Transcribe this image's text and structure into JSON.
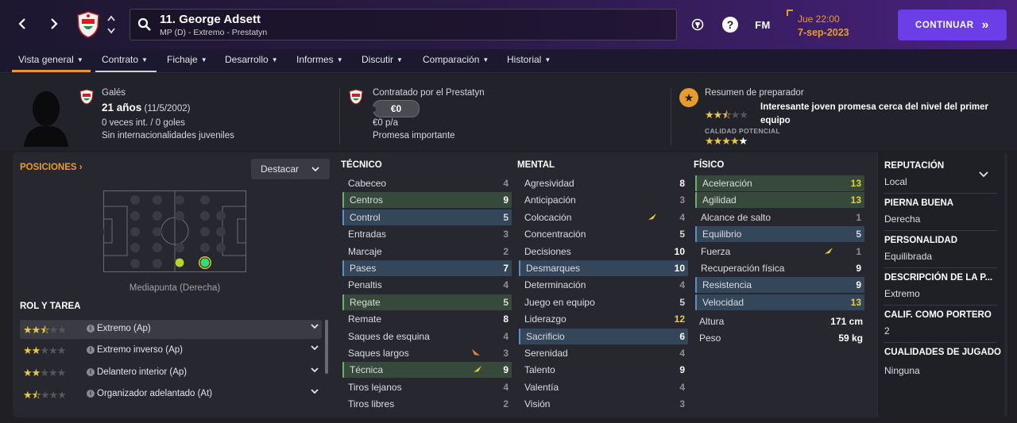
{
  "header": {
    "player_title": "11. George Adsett",
    "player_subtitle": "MP (D) - Extremo - Prestatyn",
    "date_time": "Jue 22:00",
    "date_day": "7-sep-2023",
    "fm_label": "FM",
    "help_label": "?",
    "continue_label": "CONTINUAR",
    "continue_icon": "»",
    "accent_color": "#e89b2e",
    "button_color": "#6b3ee8"
  },
  "tabs": [
    {
      "label": "Vista general"
    },
    {
      "label": "Contrato"
    },
    {
      "label": "Fichaje"
    },
    {
      "label": "Desarrollo"
    },
    {
      "label": "Informes"
    },
    {
      "label": "Discutir"
    },
    {
      "label": "Comparación"
    },
    {
      "label": "Historial"
    }
  ],
  "profile": {
    "nationality": "Galés",
    "age": "21 años",
    "dob": "(11/5/2002)",
    "caps": "0 veces int. / 0 goles",
    "youth_caps": "Sin internacionalidades juveniles",
    "contract_label": "Contratado por el Prestatyn",
    "wage": "€0",
    "wage_period": "€0 p/a",
    "status": "Promesa importante",
    "coach_title": "Resumen de preparador",
    "coach_summary": "Interesante joven promesa cerca del nivel del primer equipo",
    "potential_label": "CALIDAD POTENCIAL",
    "current_ability_stars": 2.5,
    "potential_ability_stars": 4.5
  },
  "positions": {
    "heading": "POSICIONES",
    "highlight_label": "Destacar",
    "position_name": "Mediapunta (Derecha)"
  },
  "roles": {
    "heading": "ROL Y TAREA",
    "items": [
      {
        "name": "Extremo (Ap)",
        "stars": 2.5,
        "active": true
      },
      {
        "name": "Extremo inverso (Ap)",
        "stars": 2.0,
        "active": false
      },
      {
        "name": "Delantero interior (Ap)",
        "stars": 2.0,
        "active": false
      },
      {
        "name": "Organizador adelantado (At)",
        "stars": 1.5,
        "active": false
      }
    ]
  },
  "technical": {
    "heading": "TÉCNICO",
    "attrs": [
      {
        "name": "Cabeceo",
        "value": "4",
        "hl": ""
      },
      {
        "name": "Centros",
        "value": "9",
        "hl": "green"
      },
      {
        "name": "Control",
        "value": "5",
        "hl": "blue"
      },
      {
        "name": "Entradas",
        "value": "3",
        "hl": ""
      },
      {
        "name": "Marcaje",
        "value": "2",
        "hl": ""
      },
      {
        "name": "Pases",
        "value": "7",
        "hl": "blue"
      },
      {
        "name": "Penaltis",
        "value": "4",
        "hl": ""
      },
      {
        "name": "Regate",
        "value": "5",
        "hl": "green"
      },
      {
        "name": "Remate",
        "value": "8",
        "hl": ""
      },
      {
        "name": "Saques de esquina",
        "value": "4",
        "hl": ""
      },
      {
        "name": "Saques largos",
        "value": "3",
        "hl": "",
        "trend": "down"
      },
      {
        "name": "Técnica",
        "value": "9",
        "hl": "green",
        "trend": "up"
      },
      {
        "name": "Tiros lejanos",
        "value": "4",
        "hl": ""
      },
      {
        "name": "Tiros libres",
        "value": "2",
        "hl": ""
      }
    ]
  },
  "mental": {
    "heading": "MENTAL",
    "attrs": [
      {
        "name": "Agresividad",
        "value": "8",
        "hl": ""
      },
      {
        "name": "Anticipación",
        "value": "3",
        "hl": ""
      },
      {
        "name": "Colocación",
        "value": "4",
        "hl": "",
        "trend": "up"
      },
      {
        "name": "Concentración",
        "value": "5",
        "hl": ""
      },
      {
        "name": "Decisiones",
        "value": "10",
        "hl": ""
      },
      {
        "name": "Desmarques",
        "value": "10",
        "hl": "blue"
      },
      {
        "name": "Determinación",
        "value": "4",
        "hl": ""
      },
      {
        "name": "Juego en equipo",
        "value": "5",
        "hl": ""
      },
      {
        "name": "Liderazgo",
        "value": "12",
        "hl": ""
      },
      {
        "name": "Sacrificio",
        "value": "6",
        "hl": "blue"
      },
      {
        "name": "Serenidad",
        "value": "4",
        "hl": ""
      },
      {
        "name": "Talento",
        "value": "9",
        "hl": ""
      },
      {
        "name": "Valentía",
        "value": "4",
        "hl": ""
      },
      {
        "name": "Visión",
        "value": "3",
        "hl": ""
      }
    ]
  },
  "physical": {
    "heading": "FÍSICO",
    "attrs": [
      {
        "name": "Aceleración",
        "value": "13",
        "hl": "green"
      },
      {
        "name": "Agilidad",
        "value": "13",
        "hl": "green"
      },
      {
        "name": "Alcance de salto",
        "value": "1",
        "hl": ""
      },
      {
        "name": "Equilibrio",
        "value": "5",
        "hl": "blue"
      },
      {
        "name": "Fuerza",
        "value": "1",
        "hl": "",
        "trend": "up"
      },
      {
        "name": "Recuperación física",
        "value": "9",
        "hl": ""
      },
      {
        "name": "Resistencia",
        "value": "9",
        "hl": "blue"
      },
      {
        "name": "Velocidad",
        "value": "13",
        "hl": "blue"
      }
    ],
    "height_label": "Altura",
    "height_value": "171 cm",
    "weight_label": "Peso",
    "weight_value": "59 kg"
  },
  "sidebar": {
    "items": [
      {
        "label": "REPUTACIÓN",
        "value": "Local"
      },
      {
        "label": "PIERNA BUENA",
        "value": "Derecha"
      },
      {
        "label": "PERSONALIDAD",
        "value": "Equilibrada"
      },
      {
        "label": "DESCRIPCIÓN DE LA P...",
        "value": "Extremo"
      },
      {
        "label": "CALIF. COMO PORTERO",
        "value": "2"
      },
      {
        "label": "CUALIDADES DE JUGADO",
        "value": "Ninguna"
      }
    ]
  }
}
